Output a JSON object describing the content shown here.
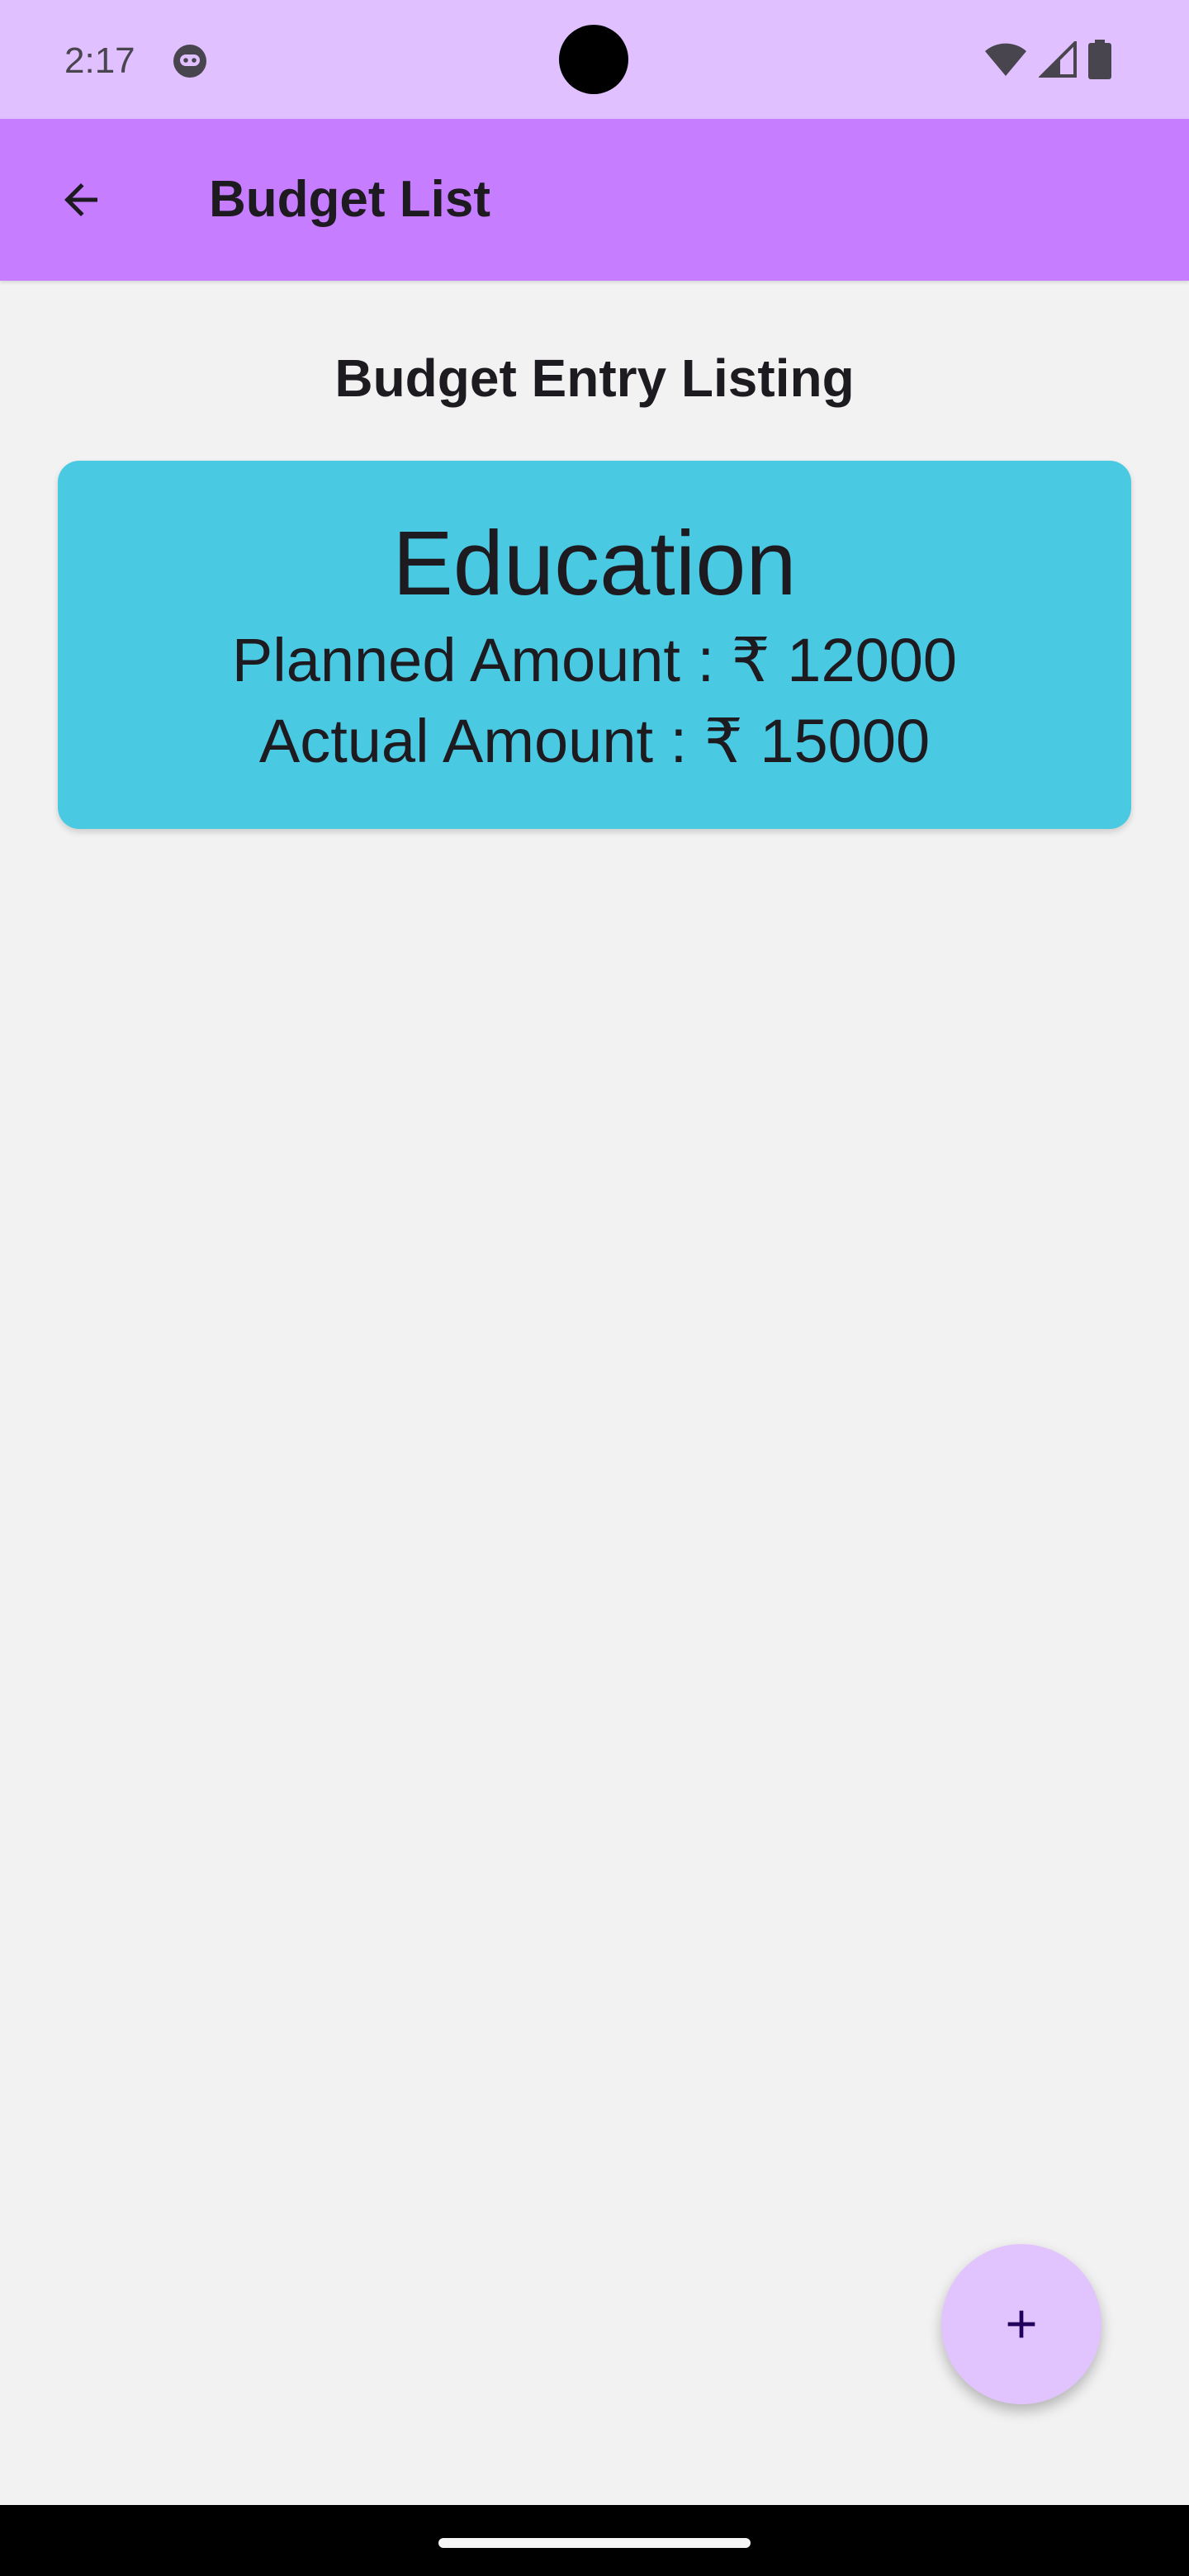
{
  "status_bar": {
    "time": "2:17",
    "icons": [
      "notification-face-icon",
      "wifi-icon",
      "cellular-signal-icon",
      "battery-icon"
    ]
  },
  "app_bar": {
    "title": "Budget List",
    "back_icon": "arrow-back-icon"
  },
  "main": {
    "heading": "Budget Entry Listing",
    "entries": [
      {
        "category": "Education",
        "planned_label": "Planned Amount : ₹ 12000",
        "actual_label": "Actual Amount : ₹ 15000"
      }
    ]
  },
  "fab": {
    "icon": "add-icon"
  },
  "colors": {
    "status_bar": "#e1c0ff",
    "app_bar": "#c77dff",
    "background": "#f2f2f2",
    "card": "#4ac9e3",
    "fab": "#e1c4fd"
  }
}
